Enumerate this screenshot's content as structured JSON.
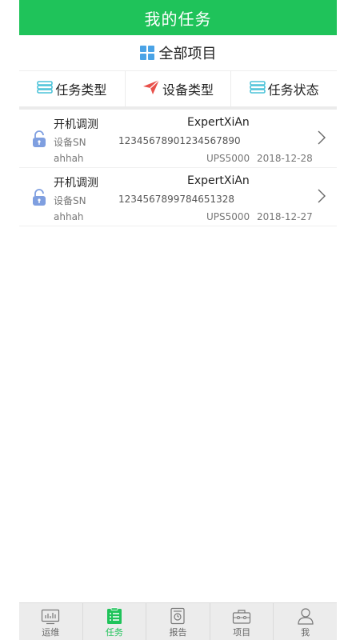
{
  "header": {
    "title": "我的任务"
  },
  "project": {
    "label": "全部项目",
    "icon": "grid-icon"
  },
  "filters": [
    {
      "label": "任务类型",
      "icon": "list-icon"
    },
    {
      "label": "设备类型",
      "icon": "paper-plane-icon"
    },
    {
      "label": "任务状态",
      "icon": "list-icon"
    }
  ],
  "tasks": [
    {
      "title": "开机调测",
      "owner": "ExpertXiAn",
      "sn_label": "设备SN",
      "sn": "12345678901234567890",
      "user": "ahhah",
      "model": "UPS5000",
      "date": "2018-12-28"
    },
    {
      "title": "开机调测",
      "owner": "ExpertXiAn",
      "sn_label": "设备SN",
      "sn": "1234567899784651328",
      "user": "ahhah",
      "model": "UPS5000",
      "date": "2018-12-27"
    }
  ],
  "tabs": [
    {
      "label": "运维",
      "icon": "monitor-icon"
    },
    {
      "label": "任务",
      "icon": "task-list-icon"
    },
    {
      "label": "报告",
      "icon": "report-icon"
    },
    {
      "label": "项目",
      "icon": "toolbox-icon"
    },
    {
      "label": "我",
      "icon": "user-icon"
    }
  ],
  "colors": {
    "accent": "#1fc35a",
    "icon_blue": "#4aa3e6",
    "lock": "#7f9fe0"
  }
}
